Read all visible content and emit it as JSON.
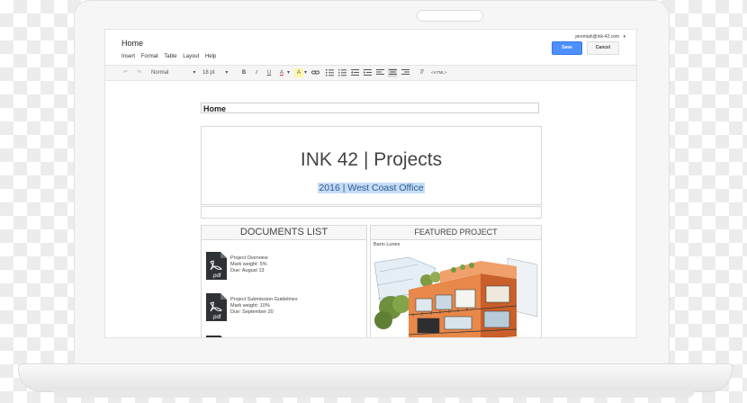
{
  "document": {
    "title": "Home",
    "menu": [
      "Insert",
      "Format",
      "Table",
      "Layout",
      "Help"
    ],
    "user_email": "jeremiah@ink-42.com",
    "save_label": "Save",
    "cancel_label": "Cancel"
  },
  "toolbar": {
    "style": "Normal",
    "font_size": "18 pt",
    "bold": "B",
    "italic": "I",
    "underline": "U",
    "text_color": "A",
    "highlight": "A",
    "html": "<HTML>"
  },
  "page": {
    "heading": "Home",
    "hero_title": "INK 42 | Projects",
    "hero_subtitle": "2016 | West Coast Office",
    "documents_header": "DOCUMENTS LIST",
    "featured_header": "FEATURED PROJECT",
    "featured_caption": "Bario Lunes",
    "documents": [
      {
        "icon": "pdf",
        "title": "Project Overview",
        "weight": "Mark weight: 5%",
        "due": "Due: August 13"
      },
      {
        "icon": "pdf",
        "title": "Project Submission Guidelines",
        "weight": "Mark weight: 10%",
        "due": "Due: September 20"
      }
    ]
  },
  "colors": {
    "primary_button": "#4d90fe",
    "highlight": "#c6dcf5"
  }
}
